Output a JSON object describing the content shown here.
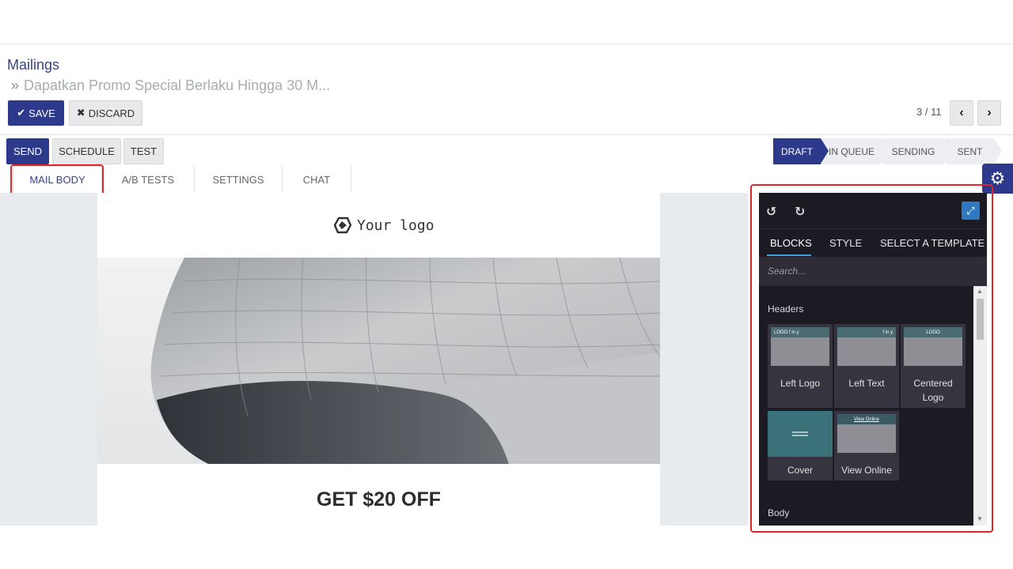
{
  "breadcrumb": {
    "root": "Mailings",
    "separator": "»",
    "current": "Dapatkan Promo Special Berlaku Hingga 30 M..."
  },
  "actions": {
    "save_label": "SAVE",
    "discard_label": "DISCARD",
    "pager": "3 / 11",
    "prev_icon": "‹",
    "next_icon": "›"
  },
  "mail_actions": {
    "send_label": "SEND",
    "schedule_label": "SCHEDULE",
    "test_label": "TEST"
  },
  "status": {
    "stages": [
      "DRAFT",
      "IN QUEUE",
      "SENDING",
      "SENT"
    ],
    "active": "DRAFT"
  },
  "tabs": [
    "MAIL BODY",
    "A/B TESTS",
    "SETTINGS",
    "CHAT"
  ],
  "mail": {
    "logo_text": "Your logo",
    "headline": "GET $20 OFF"
  },
  "editor": {
    "undo_icon": "↺",
    "redo_icon": "↻",
    "expand_icon": "⤢",
    "tabs": [
      "BLOCKS",
      "STYLE",
      "SELECT A TEMPLATE"
    ],
    "search_placeholder": "Search...",
    "sections": {
      "headers": "Headers",
      "body": "Body"
    },
    "blocks": [
      {
        "label": "Left Logo",
        "bar": "LOGO   f in y"
      },
      {
        "label": "Left Text",
        "bar": "f in y"
      },
      {
        "label": "Centered Logo",
        "bar": "LOGO"
      },
      {
        "label": "Cover",
        "bar": ""
      },
      {
        "label": "View Online",
        "bar": "View Online"
      }
    ]
  },
  "colors": {
    "primary": "#2d3a8c",
    "highlight": "#e0262c",
    "panel": "#1c1b24"
  }
}
